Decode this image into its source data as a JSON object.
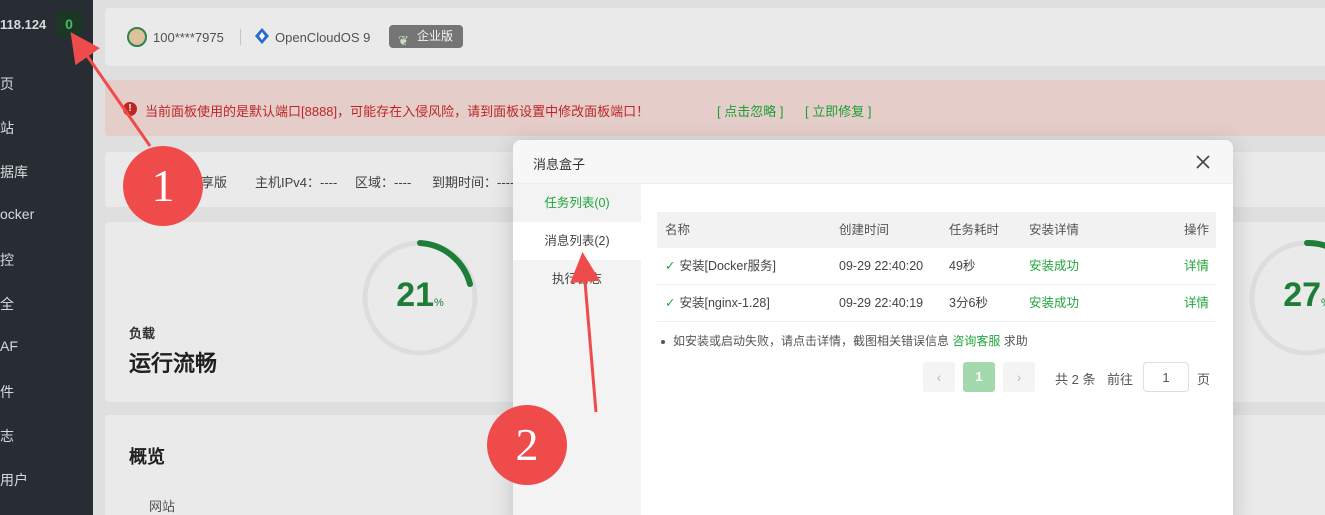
{
  "sidebar": {
    "ip": "118.124",
    "badge": "0",
    "items": [
      "页",
      "站",
      "据库",
      "ocker",
      "控",
      "全",
      "AF",
      "件",
      "志",
      "用户"
    ]
  },
  "topbar": {
    "user": "100****7975",
    "os": "OpenCloudOS 9",
    "edition": "企业版"
  },
  "alert": {
    "text": "当前面板使用的是默认端口[8888]，可能存在入侵风险，请到面板设置中修改面板端口！",
    "ignore": "[ 点击忽略 ]",
    "fix": "[ 立即修复 ]"
  },
  "info_bar": {
    "edition": "享版",
    "ipv4": "主机IPv4：----",
    "region": "区域：----",
    "expire": "到期时间：----"
  },
  "load": {
    "label": "负载",
    "status": "运行流畅",
    "gauge_left": "21",
    "gauge_right": "27",
    "unit": "%"
  },
  "overview": {
    "title": "概览",
    "site_label": "网站"
  },
  "modal": {
    "title": "消息盒子",
    "tabs": [
      "任务列表(0)",
      "消息列表(2)",
      "执行日志"
    ],
    "columns": [
      "名称",
      "创建时间",
      "任务耗时",
      "安装详情",
      "操作"
    ],
    "rows": [
      {
        "name": "安装[Docker服务]",
        "time": "09-29 22:40:20",
        "duration": "49秒",
        "status": "安装成功",
        "action": "详情"
      },
      {
        "name": "安装[nginx-1.28]",
        "time": "09-29 22:40:19",
        "duration": "3分6秒",
        "status": "安装成功",
        "action": "详情"
      }
    ],
    "note_prefix": "如安装或启动失败，请点击详情，截图相关错误信息",
    "note_link": "咨询客服",
    "note_suffix": "求助",
    "pager": {
      "prev": "‹",
      "current": "1",
      "next": "›",
      "total": "共 2 条",
      "goto": "前往",
      "page_value": "1",
      "page_unit": "页"
    }
  },
  "annotations": {
    "one": "1",
    "two": "2"
  },
  "colors": {
    "brand_green": "#20a53a",
    "alert_red": "#c62828",
    "annotation_red": "#f04b4b"
  }
}
